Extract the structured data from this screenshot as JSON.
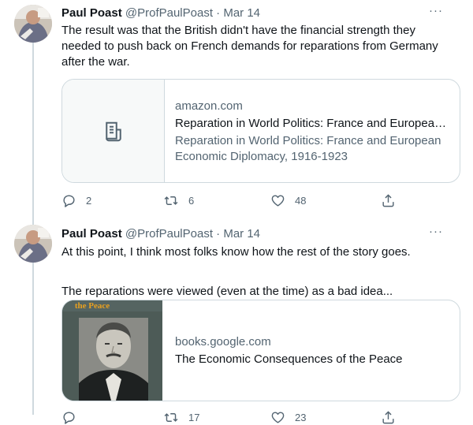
{
  "tweets": [
    {
      "name": "Paul Poast",
      "handle": "@ProfPaulPoast",
      "separator": "·",
      "date": "Mar 14",
      "more": "···",
      "text_lines": [
        "The result was that the British didn't have the financial strength they",
        "needed to push back on French demands for reparations from Germany",
        "after the war."
      ],
      "card": {
        "domain": "amazon.com",
        "title": "Reparation in World Politics: France and European...",
        "description_lines": [
          "Reparation in World Politics: France and European",
          "Economic Diplomacy, 1916-1923"
        ],
        "thumb_icon": "document-icon"
      },
      "actions": {
        "replies": "2",
        "retweets": "6",
        "likes": "48"
      }
    },
    {
      "name": "Paul Poast",
      "handle": "@ProfPaulPoast",
      "separator": "·",
      "date": "Mar 14",
      "more": "···",
      "text_lines": [
        "At this point, I think most folks know how the rest of the story goes.",
        "",
        "The reparations were viewed (even at the time) as a bad idea..."
      ],
      "card": {
        "domain": "books.google.com",
        "title": "The Economic Consequences of the Peace",
        "cover_text": "the Peace"
      },
      "actions": {
        "replies": "",
        "retweets": "17",
        "likes": "23"
      }
    }
  ],
  "colors": {
    "text": "#0f1419",
    "secondary": "#536471",
    "border": "#cfd9de",
    "thumb_bg": "#f7f9f9",
    "cover_title": "#e8a020"
  }
}
